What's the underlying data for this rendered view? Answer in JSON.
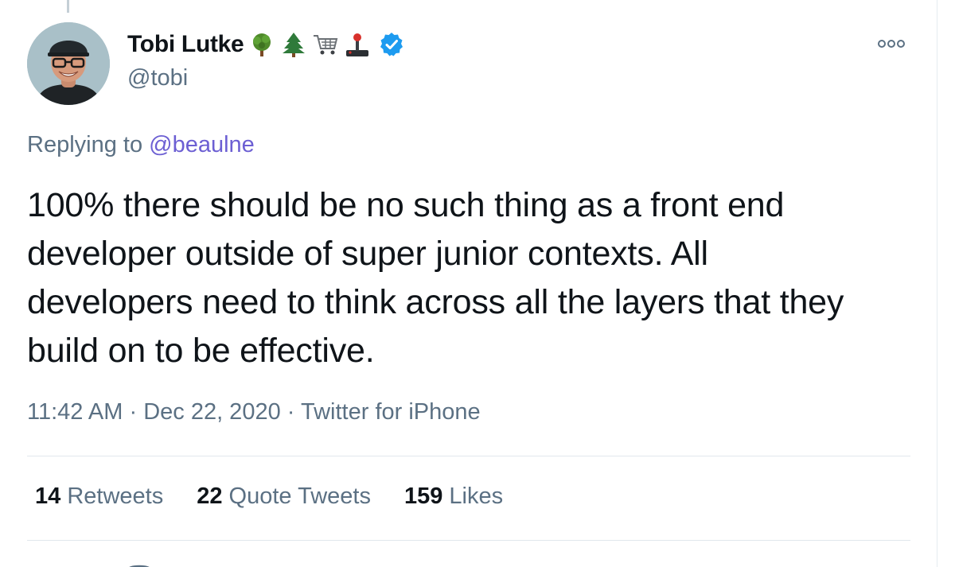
{
  "tweet": {
    "display_name": "Tobi Lutke",
    "handle": "@tobi",
    "name_emojis": [
      "deciduous-tree-icon",
      "evergreen-tree-icon",
      "shopping-cart-icon",
      "joystick-icon"
    ],
    "verified_icon": "verified-badge-icon",
    "more_icon": "more-options-icon",
    "replying_prefix": "Replying to",
    "replying_to": "@beaulne",
    "text_lines": [
      "100% there should be no such thing as a front end",
      "developer outside of super junior contexts. All",
      "developers need to think across all the layers that they",
      "build on to be effective."
    ],
    "time": "11:42 AM",
    "date": "Dec 22, 2020",
    "source": "Twitter for iPhone",
    "separator": "·"
  },
  "stats": {
    "retweets": {
      "count": "14",
      "label": "Retweets"
    },
    "quote_tweets": {
      "count": "22",
      "label": "Quote Tweets"
    },
    "likes": {
      "count": "159",
      "label": "Likes"
    }
  },
  "colors": {
    "text": "#0f1419",
    "secondary": "#5b7083",
    "mention": "#6c5fd3",
    "verified": "#1d9bf0",
    "divider": "#e1e8ed"
  }
}
